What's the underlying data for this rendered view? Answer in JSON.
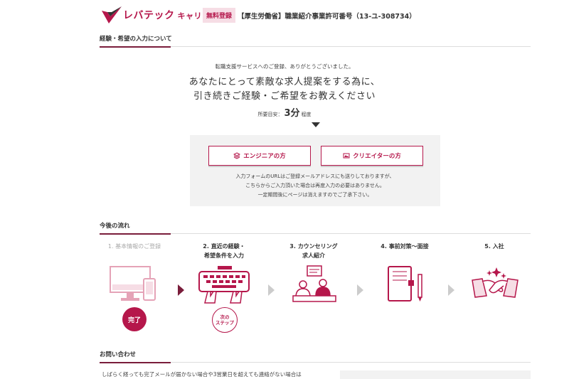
{
  "header": {
    "logo_main": "レバテック",
    "logo_sub": "キャリア",
    "badge": "無料登録",
    "license": "【厚生労働省】職業紹介事業許可番号（13-ユ-308734）"
  },
  "intro": {
    "section_title": "経験・希望の入力について",
    "thanks": "転職支援サービスへのご登録、ありがとうございました。",
    "lead_line1": "あなたにとって素敵な求人提案をする為に、",
    "lead_line2": "引き続きご経験・ご希望をお教えください",
    "time_prefix": "所要目安：",
    "time_value": "3分",
    "time_suffix": "程度"
  },
  "choices": {
    "engineer_label": "エンジニアの方",
    "creator_label": "クリエイターの方",
    "note_line1": "入力フォームのURLはご登録メールアドレスにも送りしておりますが、",
    "note_line2": "こちらからご入力頂いた場合は再度入力の必要はありません。",
    "note_line3": "一定期間後にページは消えますのでご了承下さい。"
  },
  "flow": {
    "section_title": "今後の流れ",
    "steps": [
      {
        "line1": "1. 基本情報のご登録",
        "line2": ""
      },
      {
        "line1": "2. 直近の経験・",
        "line2": "希望条件を入力"
      },
      {
        "line1": "3. カウンセリング",
        "line2": "求人紹介"
      },
      {
        "line1": "4. 事前対策〜面接",
        "line2": ""
      },
      {
        "line1": "5. 入社",
        "line2": ""
      }
    ],
    "done_label": "完了",
    "next_label_line1": "次の",
    "next_label_line2": "ステップ"
  },
  "contact": {
    "section_title": "お問い合わせ",
    "text": "しばらく経っても完了メールが届かない場合や3営業日を超えても連絡がない場合は"
  },
  "colors": {
    "accent": "#b5174b",
    "accent_dark": "#7a1d3b",
    "box_bg": "#f2f2f2"
  }
}
